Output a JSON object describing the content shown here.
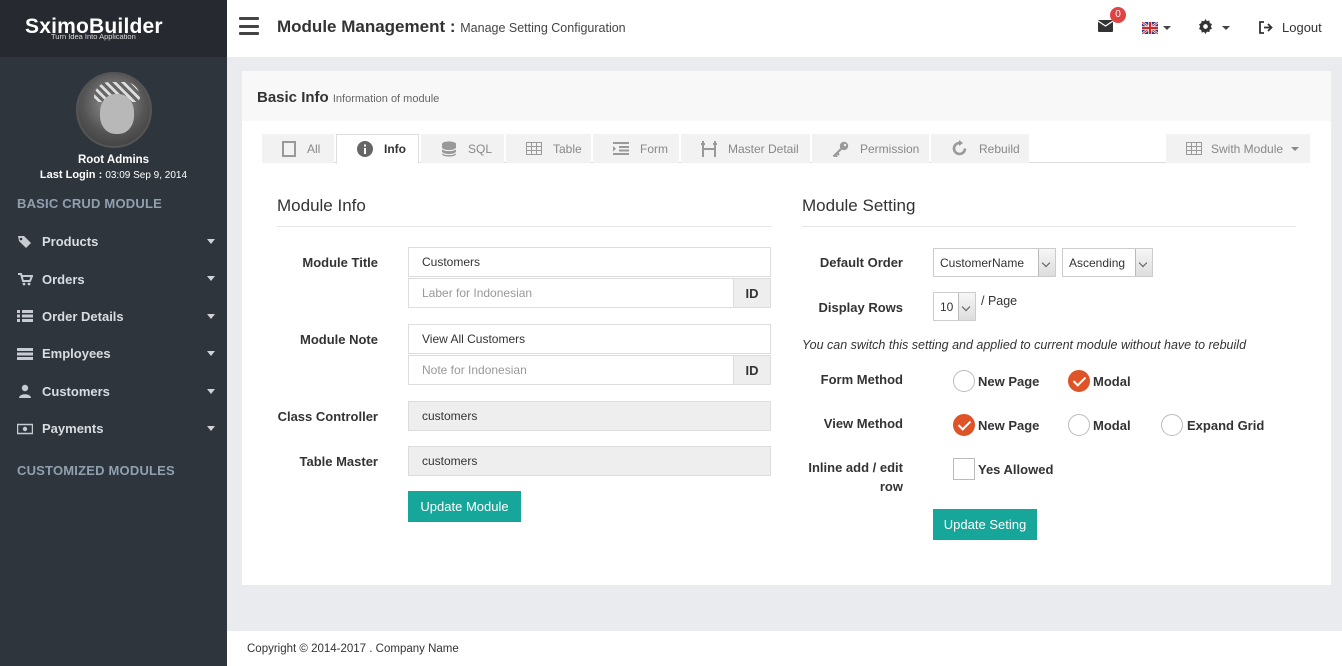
{
  "brand": {
    "logo_main": "SximoBuilder",
    "logo_tagline": "Turn Idea Into Application"
  },
  "profile": {
    "name": "Root Admins",
    "last_login_label": "Last Login :",
    "last_login_value": "03:09 Sep 9, 2014"
  },
  "sidebar": {
    "section_basic": "BASIC CRUD MODULE",
    "items": [
      {
        "label": "Products",
        "icon": "tags-icon"
      },
      {
        "label": "Orders",
        "icon": "cart-icon"
      },
      {
        "label": "Order Details",
        "icon": "list-icon"
      },
      {
        "label": "Employees",
        "icon": "server-icon"
      },
      {
        "label": "Customers",
        "icon": "user-icon"
      },
      {
        "label": "Payments",
        "icon": "money-icon"
      }
    ],
    "section_custom": "CUSTOMIZED MODULES"
  },
  "header": {
    "title": "Module Management :",
    "subtitle": "Manage Setting Configuration",
    "mail_count": "0",
    "logout": "Logout"
  },
  "panel": {
    "title": "Basic Info",
    "subtitle": "Information of module",
    "tabs": [
      "All",
      "Info",
      "SQL",
      "Table",
      "Form",
      "Master Detail",
      "Permission",
      "Rebuild"
    ],
    "active_tab": "Info",
    "switch_module": "Swith Module"
  },
  "module_info": {
    "heading": "Module Info",
    "title_label": "Module Title",
    "title_value": "Customers",
    "title_id_placeholder": "Laber for Indonesian",
    "lang_addon": "ID",
    "note_label": "Module Note",
    "note_value": "View All Customers",
    "note_id_placeholder": "Note for Indonesian",
    "controller_label": "Class Controller",
    "controller_value": "customers",
    "table_label": "Table Master",
    "table_value": "customers",
    "update_button": "Update Module"
  },
  "module_setting": {
    "heading": "Module Setting",
    "default_order_label": "Default Order",
    "order_field": "CustomerName",
    "order_direction": "Ascending",
    "display_rows_label": "Display Rows",
    "display_rows_value": "10",
    "per_page": "/ Page",
    "note": "You can switch this setting and applied to current module without have to rebuild",
    "form_method_label": "Form Method",
    "form_method_options": [
      "New Page",
      "Modal"
    ],
    "form_method_selected": "Modal",
    "view_method_label": "View Method",
    "view_method_options": [
      "New Page",
      "Modal",
      "Expand Grid"
    ],
    "view_method_selected": "New Page",
    "inline_label_1": "Inline add / edit",
    "inline_label_2": "row",
    "inline_option": "Yes Allowed",
    "update_button": "Update Seting"
  },
  "footer": {
    "copyright": "Copyright © 2014-2017 . Company Name"
  },
  "colors": {
    "accent": "#16a79a",
    "radio_on": "#de5327",
    "sidebar": "#2f353d",
    "badge": "#e04343"
  }
}
